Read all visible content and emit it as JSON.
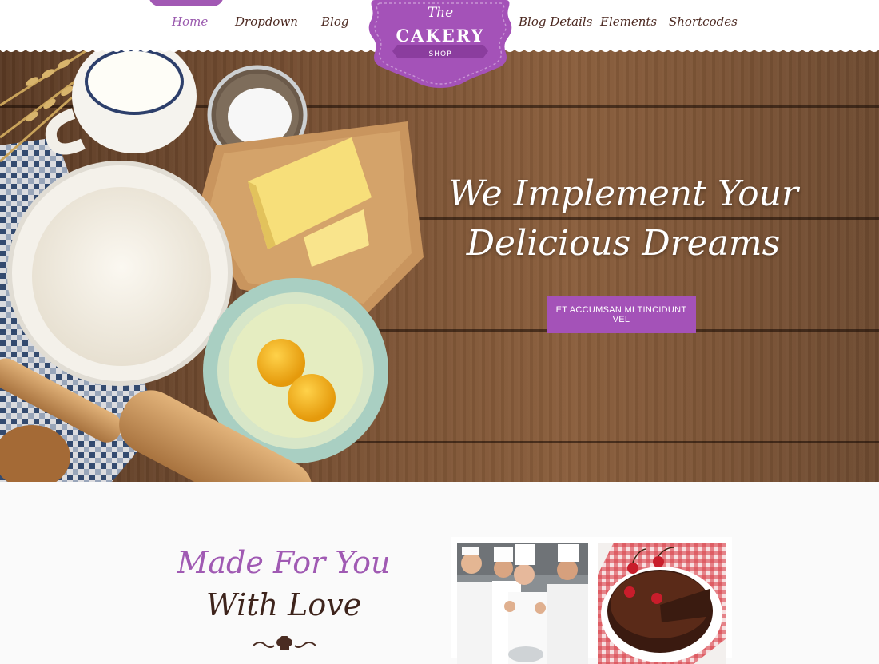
{
  "nav": {
    "left": [
      {
        "label": "Home",
        "active": true
      },
      {
        "label": "Dropdown"
      },
      {
        "label": "Blog"
      }
    ],
    "right": [
      {
        "label": "Blog Details"
      },
      {
        "label": "Elements"
      },
      {
        "label": "Shortcodes"
      }
    ]
  },
  "logo": {
    "the": "The",
    "brand": "CAKERY",
    "shop": "SHOP"
  },
  "hero": {
    "title_line1": "We Implement Your",
    "title_line2": "Delicious Dreams",
    "cta_label": "ET ACCUMSAN MI TINCIDUNT VEL"
  },
  "section": {
    "heading_line1": "Made For You",
    "heading_line2": "With Love"
  },
  "colors": {
    "accent": "#a452b8",
    "nav_text": "#4d2a22",
    "wood": "#7a5234",
    "background": "#fafafa"
  }
}
